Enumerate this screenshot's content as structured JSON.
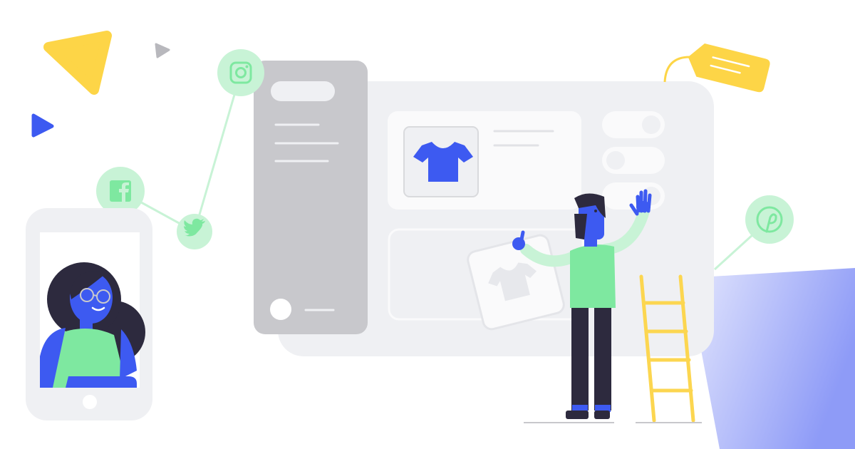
{
  "illustration": {
    "colors": {
      "background": "#ffffff",
      "panel": "#eff0f3",
      "sidebar": "#c8c8cc",
      "card": "#fafafb",
      "blue": "#3d5af1",
      "green": "#7ee8a0",
      "green_light": "#c8f3d6",
      "yellow": "#fdd547",
      "ladder": "#fcd650",
      "dark": "#2d2a3e",
      "shadow_blue": "#8e9bf7"
    },
    "social_icons": [
      "instagram-icon",
      "facebook-icon",
      "twitter-icon",
      "pinterest-icon"
    ],
    "decorations": [
      "yellow-triangle",
      "grey-triangle",
      "blue-triangle",
      "price-tag",
      "ladder"
    ],
    "people": [
      "woman-on-phone",
      "man-arranging-shop"
    ],
    "products": [
      "t-shirt-icon",
      "t-shirt-icon"
    ]
  }
}
